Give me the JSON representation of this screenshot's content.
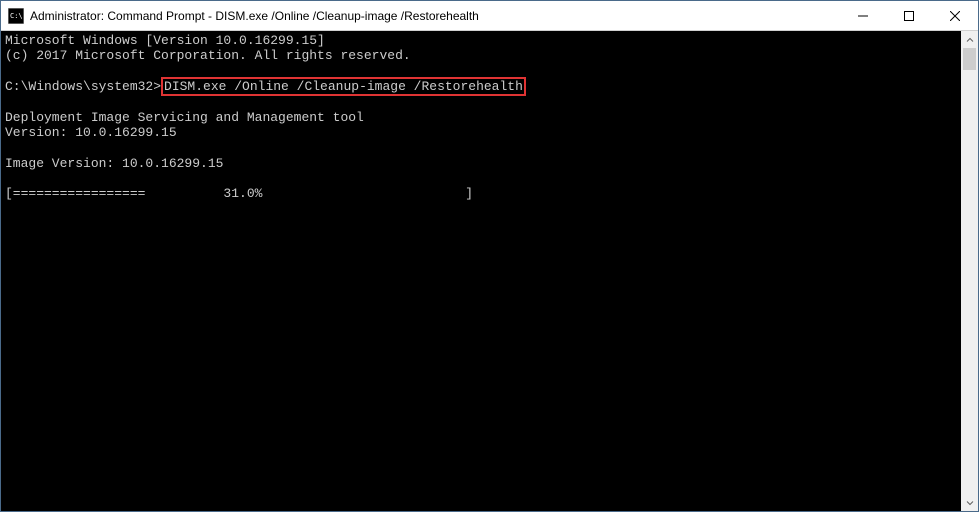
{
  "titlebar": {
    "title": "Administrator: Command Prompt - DISM.exe  /Online /Cleanup-image /Restorehealth"
  },
  "console": {
    "line1": "Microsoft Windows [Version 10.0.16299.15]",
    "line2": "(c) 2017 Microsoft Corporation. All rights reserved.",
    "prompt": "C:\\Windows\\system32>",
    "command": "DISM.exe /Online /Cleanup-image /Restorehealth",
    "tool_line": "Deployment Image Servicing and Management tool",
    "tool_version": "Version: 10.0.16299.15",
    "image_version": "Image Version: 10.0.16299.15",
    "progress": "[=================          31.0%                          ]"
  }
}
